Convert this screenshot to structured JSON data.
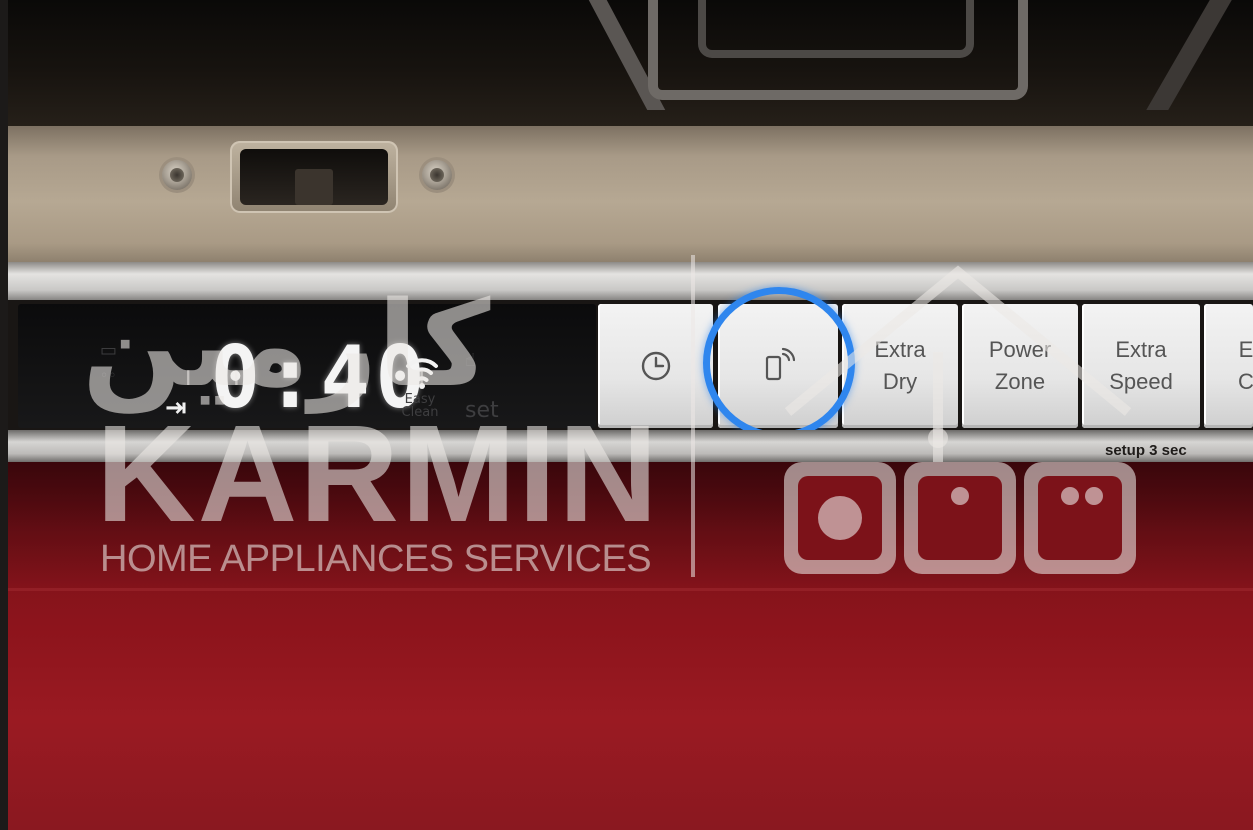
{
  "display": {
    "time": "0:40",
    "set_label": "set",
    "easy_clean_label": "Easy\nClean"
  },
  "buttons": [
    {
      "label": "",
      "icon": "clock-icon"
    },
    {
      "label": "",
      "icon": "remote-start-icon"
    },
    {
      "label": "Extra\nDry",
      "icon": ""
    },
    {
      "label": "Power\nZone",
      "icon": ""
    },
    {
      "label": "Extra\nSpeed",
      "icon": ""
    },
    {
      "label": "E\nC",
      "icon": ""
    }
  ],
  "setup_label": "setup 3 sec",
  "watermark": {
    "arabic": "کارمین",
    "brand": "KARMIN",
    "tagline": "HOME APPLIANCES SERVICES"
  },
  "colors": {
    "door_red": "#8d141c",
    "highlight_ring": "#2f86ee",
    "lid_bronze": "#b6a893"
  }
}
